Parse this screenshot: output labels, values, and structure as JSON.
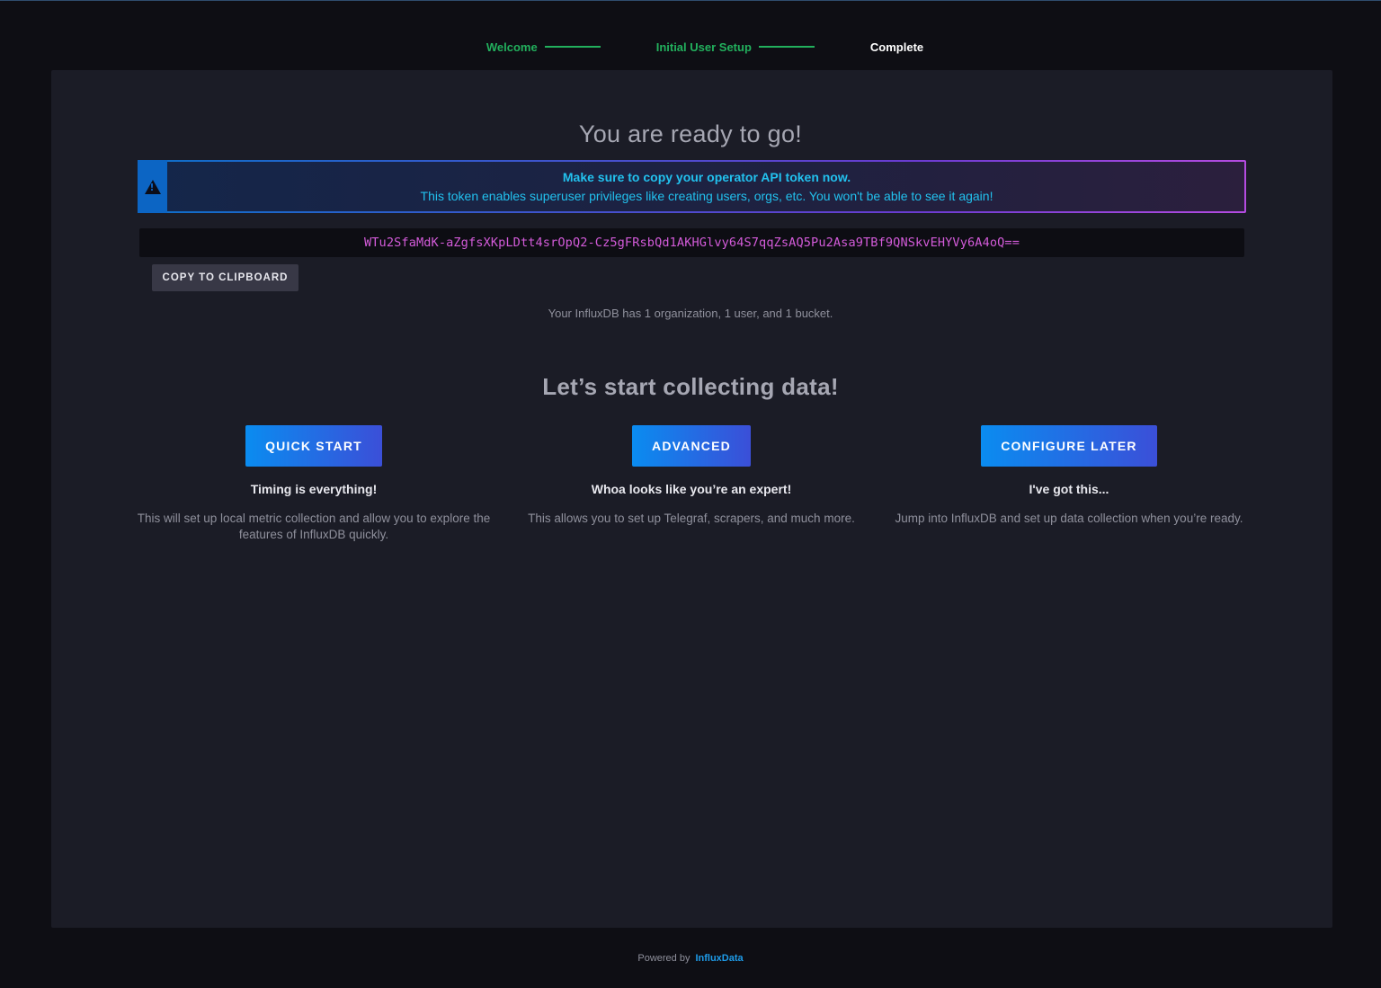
{
  "stepper": {
    "steps": [
      {
        "label": "Welcome",
        "state": "done"
      },
      {
        "label": "Initial User Setup",
        "state": "done"
      },
      {
        "label": "Complete",
        "state": "current"
      }
    ]
  },
  "main": {
    "title": "You are ready to go!",
    "alert": {
      "icon": "alert-triangle-icon",
      "headline": "Make sure to copy your operator API token now.",
      "message": "This token enables superuser privileges like creating users, orgs, etc. You won't be able to see it again!"
    },
    "token": "WTu2SfaMdK-aZgfsXKpLDtt4srOpQ2-Cz5gFRsbQd1AKHGlvy64S7qqZsAQ5Pu2Asa9TBf9QNSkvEHYVy6A4oQ==",
    "copy_label": "COPY TO CLIPBOARD",
    "summary": "Your InfluxDB has 1 organization, 1 user, and 1 bucket.",
    "collect_title": "Let’s start collecting data!",
    "options": [
      {
        "button": "QUICK START",
        "heading": "Timing is everything!",
        "description": "This will set up local metric collection and allow you to explore the features of InfluxDB quickly."
      },
      {
        "button": "ADVANCED",
        "heading": "Whoa looks like you’re an expert!",
        "description": "This allows you to set up Telegraf, scrapers, and much more."
      },
      {
        "button": "CONFIGURE LATER",
        "heading": "I've got this...",
        "description": "Jump into InfluxDB and set up data collection when you’re ready."
      }
    ]
  },
  "footer": {
    "powered_by": "Powered by",
    "brand": "InfluxData"
  },
  "colors": {
    "step_done": "#22b05d",
    "alert_text": "#22c1ee",
    "token_text": "#d35bd9",
    "button_gradient_start": "#0a8cf0",
    "button_gradient_end": "#3b4fd8",
    "brand": "#1e9be8"
  }
}
